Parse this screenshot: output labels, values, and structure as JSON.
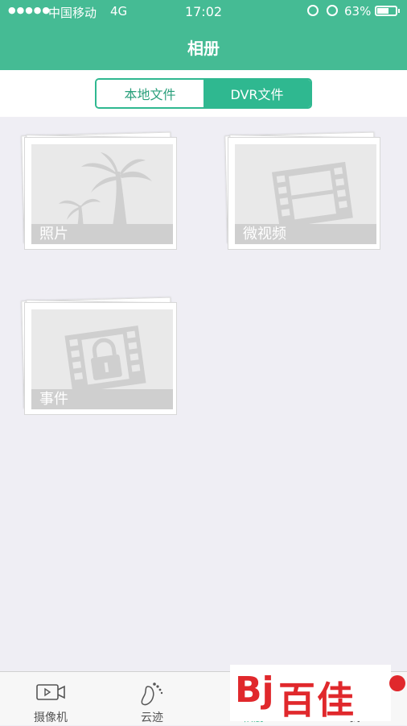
{
  "status_bar": {
    "signal": "●●●●●",
    "carrier": "中国移动",
    "network": "4G",
    "time": "17:02",
    "battery": "63%",
    "battery_level": 0.63
  },
  "header": {
    "title": "相册"
  },
  "segment": {
    "local_label": "本地文件",
    "dvr_label": "DVR文件",
    "selected": "DVR文件"
  },
  "albums": [
    {
      "label": "照片",
      "icon": "palm-tree-icon"
    },
    {
      "label": "微视频",
      "icon": "film-strip-icon"
    },
    {
      "label": "事件",
      "icon": "film-lock-icon"
    }
  ],
  "bottom_tabs": [
    {
      "label": "摄像机",
      "icon": "camera-icon"
    },
    {
      "label": "云迹",
      "icon": "footprint-icon"
    },
    {
      "label": "相册",
      "icon": "album-icon",
      "active": true
    },
    {
      "label": "我",
      "icon": "profile-icon"
    }
  ],
  "watermark": {
    "text": "百佳"
  },
  "colors": {
    "accent": "#45bb94",
    "segment": "#2fb890",
    "background": "#efeef4"
  }
}
